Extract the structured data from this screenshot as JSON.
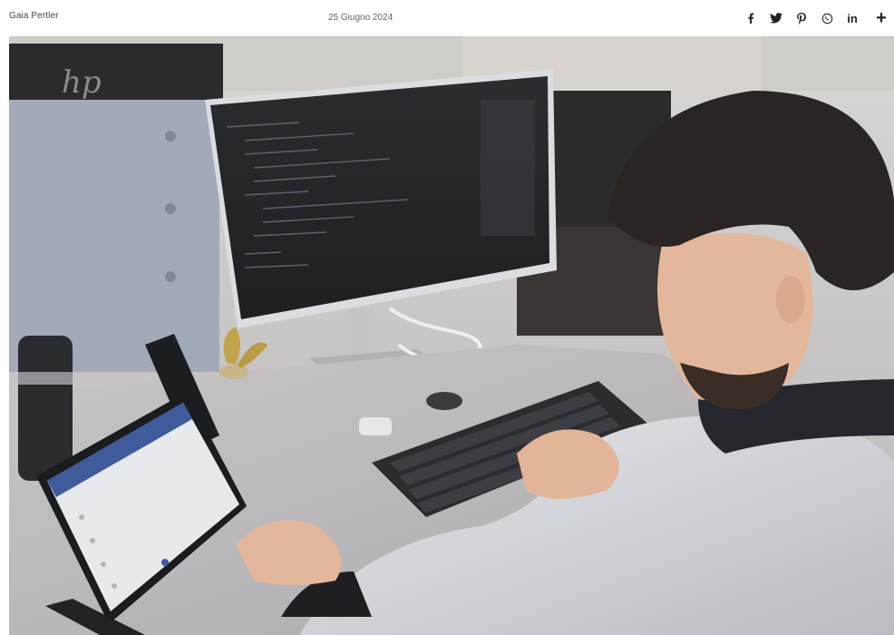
{
  "header": {
    "author": "Gaia Pertler",
    "date": "25 Giugno 2024"
  },
  "share": {
    "items": [
      {
        "name": "facebook",
        "icon": "facebook-icon"
      },
      {
        "name": "twitter",
        "icon": "twitter-icon"
      },
      {
        "name": "pinterest",
        "icon": "pinterest-icon"
      },
      {
        "name": "whatsapp",
        "icon": "whatsapp-icon"
      },
      {
        "name": "linkedin",
        "icon": "linkedin-icon",
        "label": "in"
      },
      {
        "name": "more",
        "icon": "plus-icon",
        "label": "+"
      }
    ]
  },
  "photo": {
    "brand_on_monitor": "hp"
  },
  "colors": {
    "background": "#ffffff",
    "icon": "#222222",
    "text": "#444444"
  }
}
